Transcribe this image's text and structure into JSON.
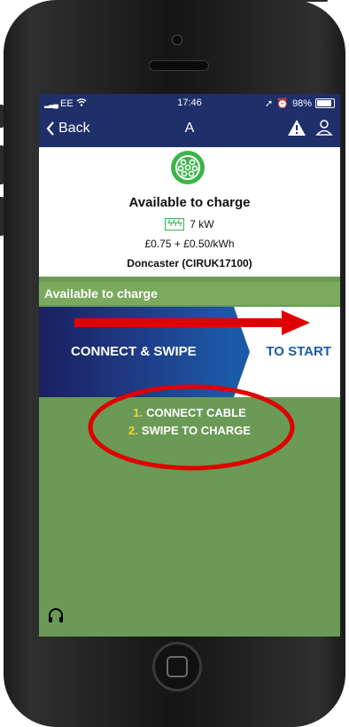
{
  "status_bar": {
    "carrier": "EE",
    "time": "17:46",
    "battery": "98%"
  },
  "nav": {
    "back_label": "Back",
    "title": "A"
  },
  "charger": {
    "status": "Available to charge",
    "power": "7 kW",
    "price": "£0.75 + £0.50/kWh",
    "location": "Doncaster (CIRUK17100)"
  },
  "availability_bar": "Available to charge",
  "swipe": {
    "left_text": "CONNECT & SWIPE",
    "right_text": "TO START"
  },
  "instructions": [
    {
      "num": "1.",
      "text": "CONNECT CABLE"
    },
    {
      "num": "2.",
      "text": "SWIPE TO CHARGE"
    }
  ],
  "colors": {
    "nav_bg": "#1f2f6a",
    "screen_green": "#6a9a56",
    "plug_green": "#3bb54a",
    "swipe_blue": "#1c5aa8",
    "annotation_red": "#e00000",
    "number_yellow": "#f6d23a"
  },
  "icons": {
    "back": "chevron-left-icon",
    "warning": "warning-triangle-icon",
    "user": "user-icon",
    "plug": "type2-plug-icon",
    "headset": "headset-icon",
    "signal": "signal-icon",
    "wifi": "wifi-icon",
    "location": "location-arrow-icon",
    "alarm": "alarm-icon",
    "battery": "battery-icon"
  }
}
